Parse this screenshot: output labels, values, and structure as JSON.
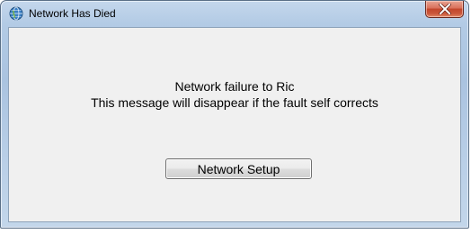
{
  "window": {
    "title": "Network Has Died",
    "app_icon": "globe-icon",
    "close_icon": "close-icon"
  },
  "message": {
    "line1": "Network failure to Ric",
    "line2": "This message will disappear if the fault self corrects"
  },
  "buttons": {
    "network_setup_label": "Network Setup"
  },
  "colors": {
    "close_button": "#c2452b",
    "frame": "#b3cbe5",
    "client_bg": "#f0f0f0"
  }
}
